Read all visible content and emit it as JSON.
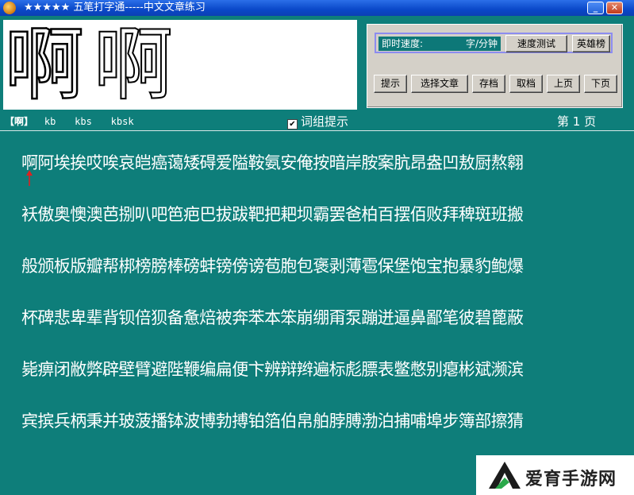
{
  "window": {
    "title": "★★★★★ 五笔打字通-----中文文章练习",
    "min_label": "_",
    "close_label": "✕"
  },
  "char_display": {
    "char1": "啊",
    "char2": "啊"
  },
  "panel": {
    "speed_label": "即时速度:",
    "speed_unit": "字/分钟",
    "buttons": {
      "speed_test": "速度测试",
      "leaderboard": "英雄榜",
      "hint": "提示",
      "select_article": "选择文章",
      "save": "存档",
      "load": "取档",
      "prev_page": "上页",
      "next_page": "下页"
    }
  },
  "info": {
    "char_bracket": "【啊】",
    "codes": [
      "kb",
      "kbs",
      "kbsk"
    ],
    "phrase_hint_label": "词组提示",
    "phrase_hint_checked": true,
    "page": "第 1 页"
  },
  "article_lines": [
    "啊阿埃挨哎唉哀皑癌蔼矮碍爱隘鞍氨安俺按暗岸胺案肮昂盎凹敖厨熬翱",
    "袄傲奥懊澳芭捌叭吧笆疤巴拔跋靶把耙坝霸罢爸柏百摆佰败拜稗斑班搬",
    "般颁板版瓣帮梆榜膀棒磅蚌镑傍谤苞胞包褒剥薄雹保堡饱宝抱暴豹鲍爆",
    "杯碑悲卑辈背钡倍狈备惫焙被奔苯本笨崩绷甭泵蹦迸逼鼻鄙笔彼碧蓖蔽",
    "毙痹闭敝弊辟壁臂避陛鞭编扁便卞辨辩辫遍标彪膘表鳖憋别瘪彬斌濒滨",
    "宾摈兵柄秉并玻菠播钵波博勃搏铂箔伯帛舶脖膊渤泊捕哺埠步簿部擦猜"
  ],
  "cursor": {
    "color": "#e02020"
  },
  "watermark": {
    "text": "爱育手游网",
    "accent": "#2aa84a"
  }
}
